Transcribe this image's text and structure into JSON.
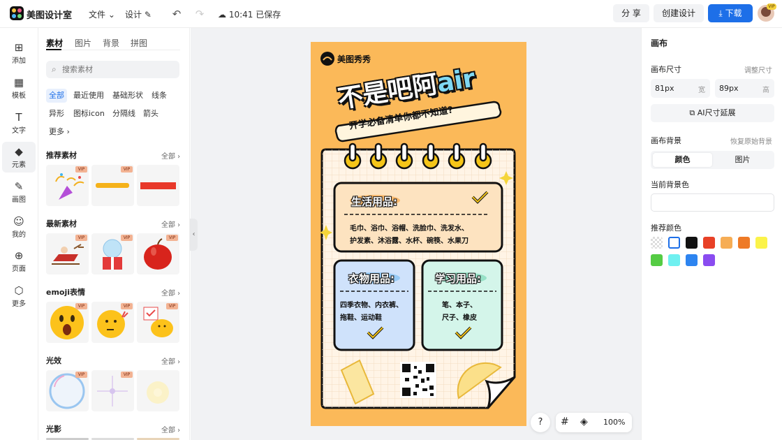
{
  "app": {
    "title": "美图设计室"
  },
  "topbar": {
    "file_menu": "文件",
    "design_menu": "设计",
    "save_status": "10:41 已保存",
    "share_label": "分 享",
    "create_label": "创建设计",
    "download_label": "下载"
  },
  "rail": {
    "items": [
      {
        "label": "添加",
        "icon": "plus-box-icon"
      },
      {
        "label": "模板",
        "icon": "template-icon"
      },
      {
        "label": "文字",
        "icon": "text-icon"
      },
      {
        "label": "元素",
        "icon": "shapes-icon"
      },
      {
        "label": "画图",
        "icon": "pen-icon"
      },
      {
        "label": "我的",
        "icon": "user-icon"
      },
      {
        "label": "页面",
        "icon": "page-add-icon"
      },
      {
        "label": "更多",
        "icon": "cube-icon"
      }
    ]
  },
  "panel": {
    "tabs": [
      "素材",
      "图片",
      "背景",
      "拼图"
    ],
    "search_placeholder": "搜索素材",
    "chips": [
      "全部",
      "最近使用",
      "基础形状",
      "线条",
      "异形",
      "图标icon",
      "分隔线",
      "箭头",
      "更多"
    ],
    "all_label": "全部",
    "vip": "VIP",
    "sections": [
      "推荐素材",
      "最新素材",
      "emoji表情",
      "光效",
      "光影"
    ]
  },
  "poster": {
    "brand": "美图秀秀",
    "title_a": "不是吧阿",
    "title_b": "air",
    "subtitle": "开学必备清单你都不知道?",
    "life_title": "生活用品:",
    "life_line1": "毛巾、浴巾、浴帽、洗脸巾、洗发水、",
    "life_line2": "护发素、沐浴露、水杯、碗筷、水果刀",
    "clothes_title": "衣物用品:",
    "clothes_line1": "四季衣物、内衣裤、",
    "clothes_line2": "拖鞋、运动鞋",
    "study_title": "学习用品:",
    "study_line1": "笔、本子、",
    "study_line2": "尺子、橡皮"
  },
  "bottom": {
    "help": "?",
    "zoom": "100%"
  },
  "right": {
    "heading": "画布",
    "size_label": "画布尺寸",
    "adjust_label": "调整尺寸",
    "width_value": "81px",
    "width_unit": "宽",
    "height_value": "89px",
    "height_unit": "高",
    "ai_extend": "AI尺寸延展",
    "bg_label": "画布背景",
    "restore_label": "恢复原始背景",
    "seg_color": "颜色",
    "seg_image": "图片",
    "current_bg": "当前背景色",
    "current_bg_value": "",
    "recommend": "推荐颜色",
    "swatches": [
      "transparent",
      "#ffffff",
      "#111111",
      "#e84127",
      "#f6ad55",
      "#ee7a26",
      "#fbf34a",
      "#55cc44",
      "#6ff0f0",
      "#2d84f0",
      "#8a4cf0"
    ]
  },
  "colors": {
    "accent": "#1d6fe8",
    "poster_bg": "#fbb959"
  }
}
